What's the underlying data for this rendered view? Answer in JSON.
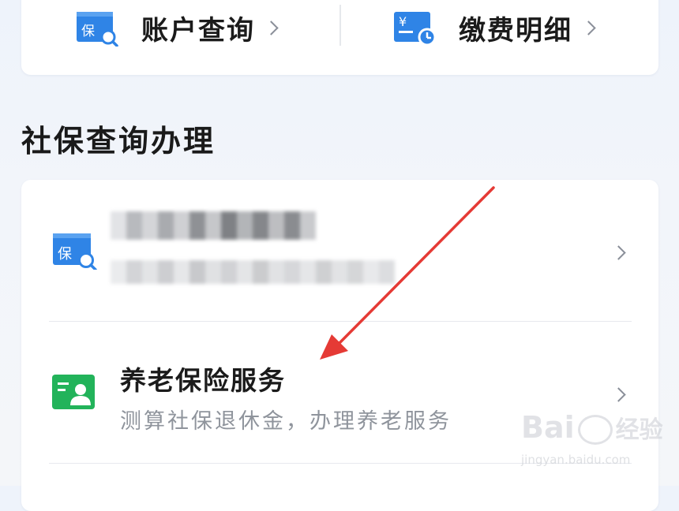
{
  "top_shortcuts": [
    {
      "label": "账户查询",
      "icon": "social-security-search-icon"
    },
    {
      "label": "缴费明细",
      "icon": "payment-detail-clock-icon"
    }
  ],
  "section_title": "社保查询办理",
  "services": [
    {
      "title": "",
      "subtitle": "",
      "icon": "social-security-search-icon",
      "redacted": true
    },
    {
      "title": "养老保险服务",
      "subtitle": "测算社保退休金，办理养老服务",
      "icon": "pension-service-icon"
    }
  ],
  "watermark": {
    "brand": "Bai",
    "brand_suffix": "经验",
    "url": "jingyan.baidu.com"
  },
  "colors": {
    "blue_icon": "#2f84e6",
    "green_icon": "#22b35a",
    "arrow": "#e53a35"
  }
}
